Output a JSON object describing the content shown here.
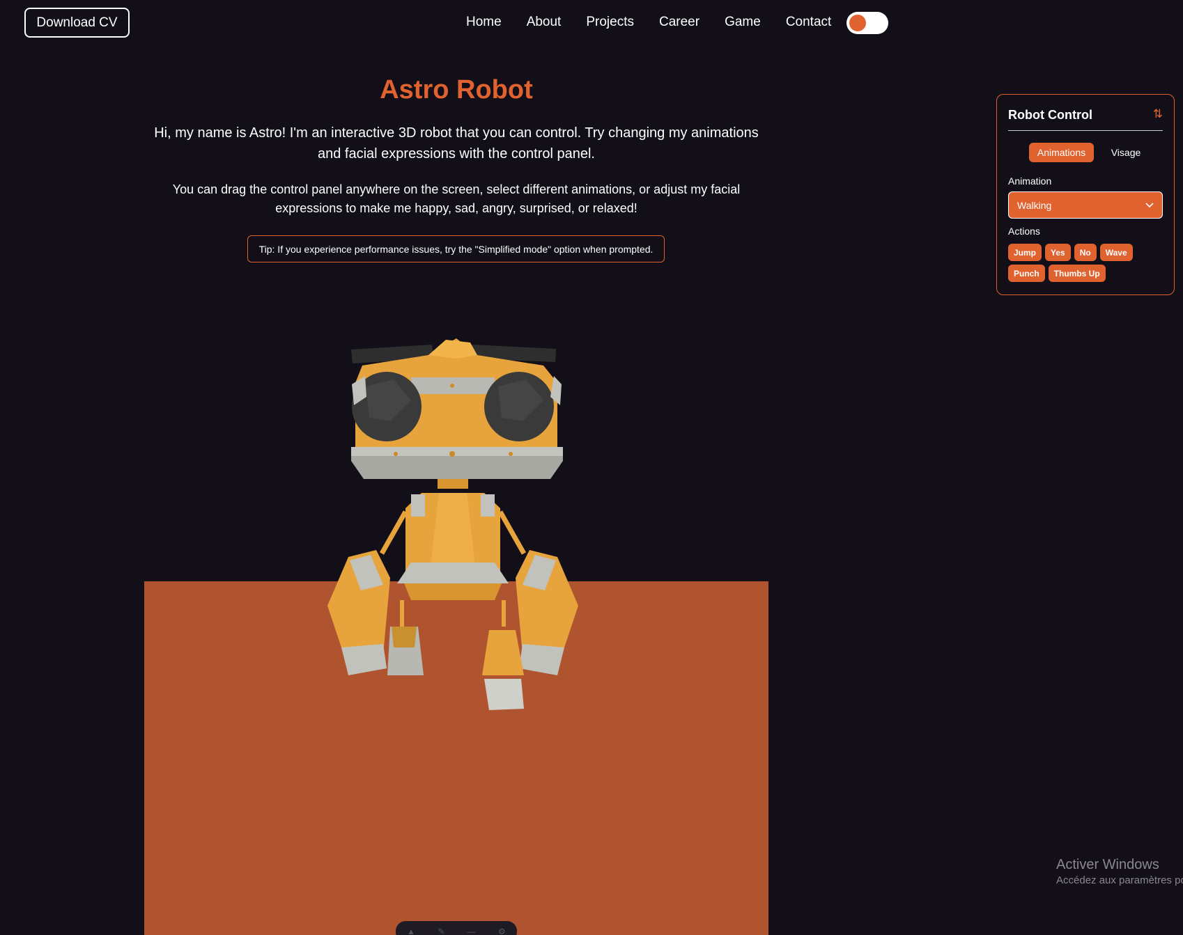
{
  "header": {
    "download_cv": "Download CV",
    "nav": [
      "Home",
      "About",
      "Projects",
      "Career",
      "Game",
      "Contact"
    ]
  },
  "main": {
    "title": "Astro Robot",
    "intro": "Hi, my name is Astro! I'm an interactive 3D robot that you can control. Try changing my animations and facial expressions with the control panel.",
    "intro2": "You can drag the control panel anywhere on the screen, select different animations, or adjust my facial expressions to make me happy, sad, angry, surprised, or relaxed!",
    "tip": "Tip: If you experience performance issues, try the \"Simplified mode\" option when prompted."
  },
  "panel": {
    "title": "Robot Control",
    "tabs": [
      "Animations",
      "Visage"
    ],
    "animation_label": "Animation",
    "animation_value": "Walking",
    "actions_label": "Actions",
    "actions": [
      "Jump",
      "Yes",
      "No",
      "Wave",
      "Punch",
      "Thumbs Up"
    ]
  },
  "watermark": {
    "title": "Activer Windows",
    "subtitle": "Accédez aux paramètres po"
  },
  "colors": {
    "accent": "#e0622f",
    "background": "#130f19",
    "floor": "#b05430",
    "robot_body": "#e8a43c"
  }
}
